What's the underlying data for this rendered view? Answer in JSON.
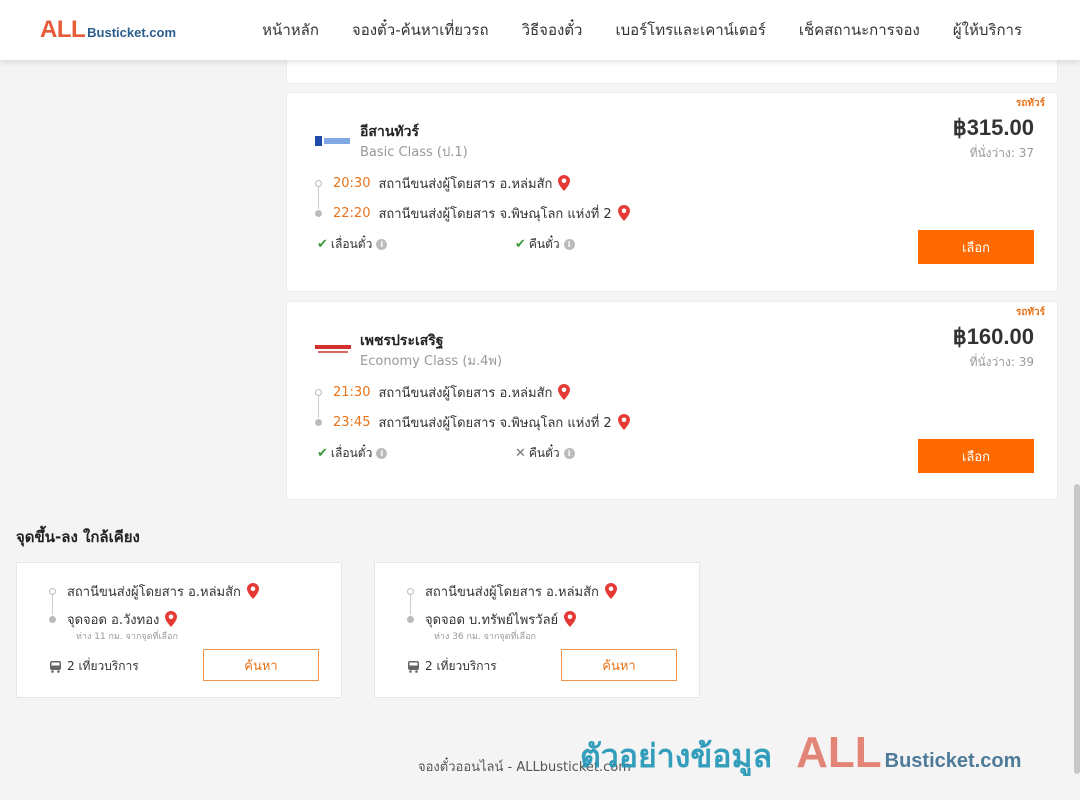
{
  "header": {
    "logo_all": "ALL",
    "logo_rest": "Busticket.com",
    "nav": [
      "หน้าหลัก",
      "จองตั๋ว-ค้นหาเที่ยวรถ",
      "วิธีจองตั๋ว",
      "เบอร์โทรและเคาน์เตอร์",
      "เช็คสถานะการจอง",
      "ผู้ให้บริการ"
    ]
  },
  "results": [
    {
      "badge": "รถทัวร์",
      "operator": "อีสานทัวร์",
      "class": "Basic Class (ป.1)",
      "price": "฿315.00",
      "seats": "ที่นั่งว่าง: 37",
      "dep_time": "20:30",
      "dep_station": "สถานีขนส่งผู้โดยสาร อ.หล่มสัก",
      "arr_time": "22:20",
      "arr_station": "สถานีขนส่งผู้โดยสาร จ.พิษณุโลก แห่งที่ 2",
      "feature1": "เลื่อนตั๋ว",
      "feature2": "คืนตั๋ว",
      "select_label": "เลือก"
    },
    {
      "badge": "รถทัวร์",
      "operator": "เพชรประเสริฐ",
      "class": "Economy Class (ม.4พ)",
      "price": "฿160.00",
      "seats": "ที่นั่งว่าง: 39",
      "dep_time": "21:30",
      "dep_station": "สถานีขนส่งผู้โดยสาร อ.หล่มสัก",
      "arr_time": "23:45",
      "arr_station": "สถานีขนส่งผู้โดยสาร จ.พิษณุโลก แห่งที่ 2",
      "feature1": "เลื่อนตั๋ว",
      "feature2": "คืนตั๋ว",
      "select_label": "เลือก"
    }
  ],
  "nearby": {
    "title": "จุดขึ้น-ลง ใกล้เคียง",
    "items": [
      {
        "from": "สถานีขนส่งผู้โดยสาร อ.หล่มสัก",
        "to": "จุดจอด อ.วังทอง",
        "distance": "ห่าง 11 กม. จากจุดที่เลือก",
        "trips": "2 เที่ยวบริการ",
        "search_label": "ค้นหา"
      },
      {
        "from": "สถานีขนส่งผู้โดยสาร อ.หล่มสัก",
        "to": "จุดจอด บ.ทรัพย์ไพรวัลย์",
        "distance": "ห่าง 36 กม. จากจุดที่เลือก",
        "trips": "2 เที่ยวบริการ",
        "search_label": "ค้นหา"
      }
    ]
  },
  "footer": {
    "text": "จองตั๋วออนไลน์ - ALLbusticket.com"
  },
  "watermark": {
    "thai": "ตัวอย่างข้อมูล",
    "all": "ALL",
    "rest": "Busticket.com"
  },
  "colors": {
    "accent": "#ff6a00",
    "time": "#e8731a",
    "ok": "#3a9a3a",
    "pin": "#e53935"
  },
  "icons": [
    "pin-icon",
    "check-icon",
    "cross-icon",
    "info-icon",
    "bus-icon"
  ]
}
